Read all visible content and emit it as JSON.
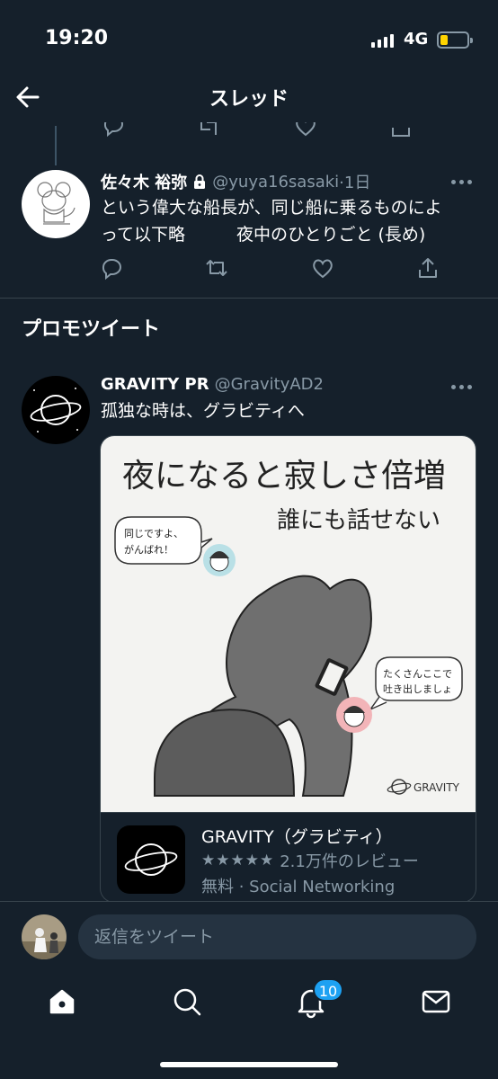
{
  "status_bar": {
    "time": "19:20",
    "network": "4G"
  },
  "header": {
    "title": "スレッド"
  },
  "tweet": {
    "name": "佐々木 裕弥",
    "handle": "@yuya16sasaki",
    "time": "·1日",
    "text_line1": "という偉大な船長が、同じ船に乗るものによ",
    "text_line2": "って以下略　　　夜中のひとりごと (長め)"
  },
  "section": {
    "title": "プロモツイート"
  },
  "promo": {
    "name": "GRAVITY PR",
    "handle": "@GravityAD2",
    "text": "孤独な時は、グラビティへ",
    "image": {
      "headline": "夜になると寂しさ倍増",
      "subheadline": "誰にも話せない",
      "bubble_left_1": "同じですよ、",
      "bubble_left_2": "がんばれ！",
      "bubble_right_1": "たくさんここで",
      "bubble_right_2": "吐き出しましょ",
      "logo_text": "GRAVITY"
    },
    "app": {
      "name": "GRAVITY（グラビティ）",
      "rating": 4.5,
      "stars_display": "★★★★★",
      "reviews": "2.1万件のレビュー",
      "price_category": "無料 · Social Networking"
    }
  },
  "reply": {
    "placeholder": "返信をツイート"
  },
  "tab_bar": {
    "notification_count": "10"
  },
  "colors": {
    "background": "#15202b",
    "accent": "#1da1f2",
    "secondary_text": "#8899a6",
    "divider": "#38444d"
  }
}
